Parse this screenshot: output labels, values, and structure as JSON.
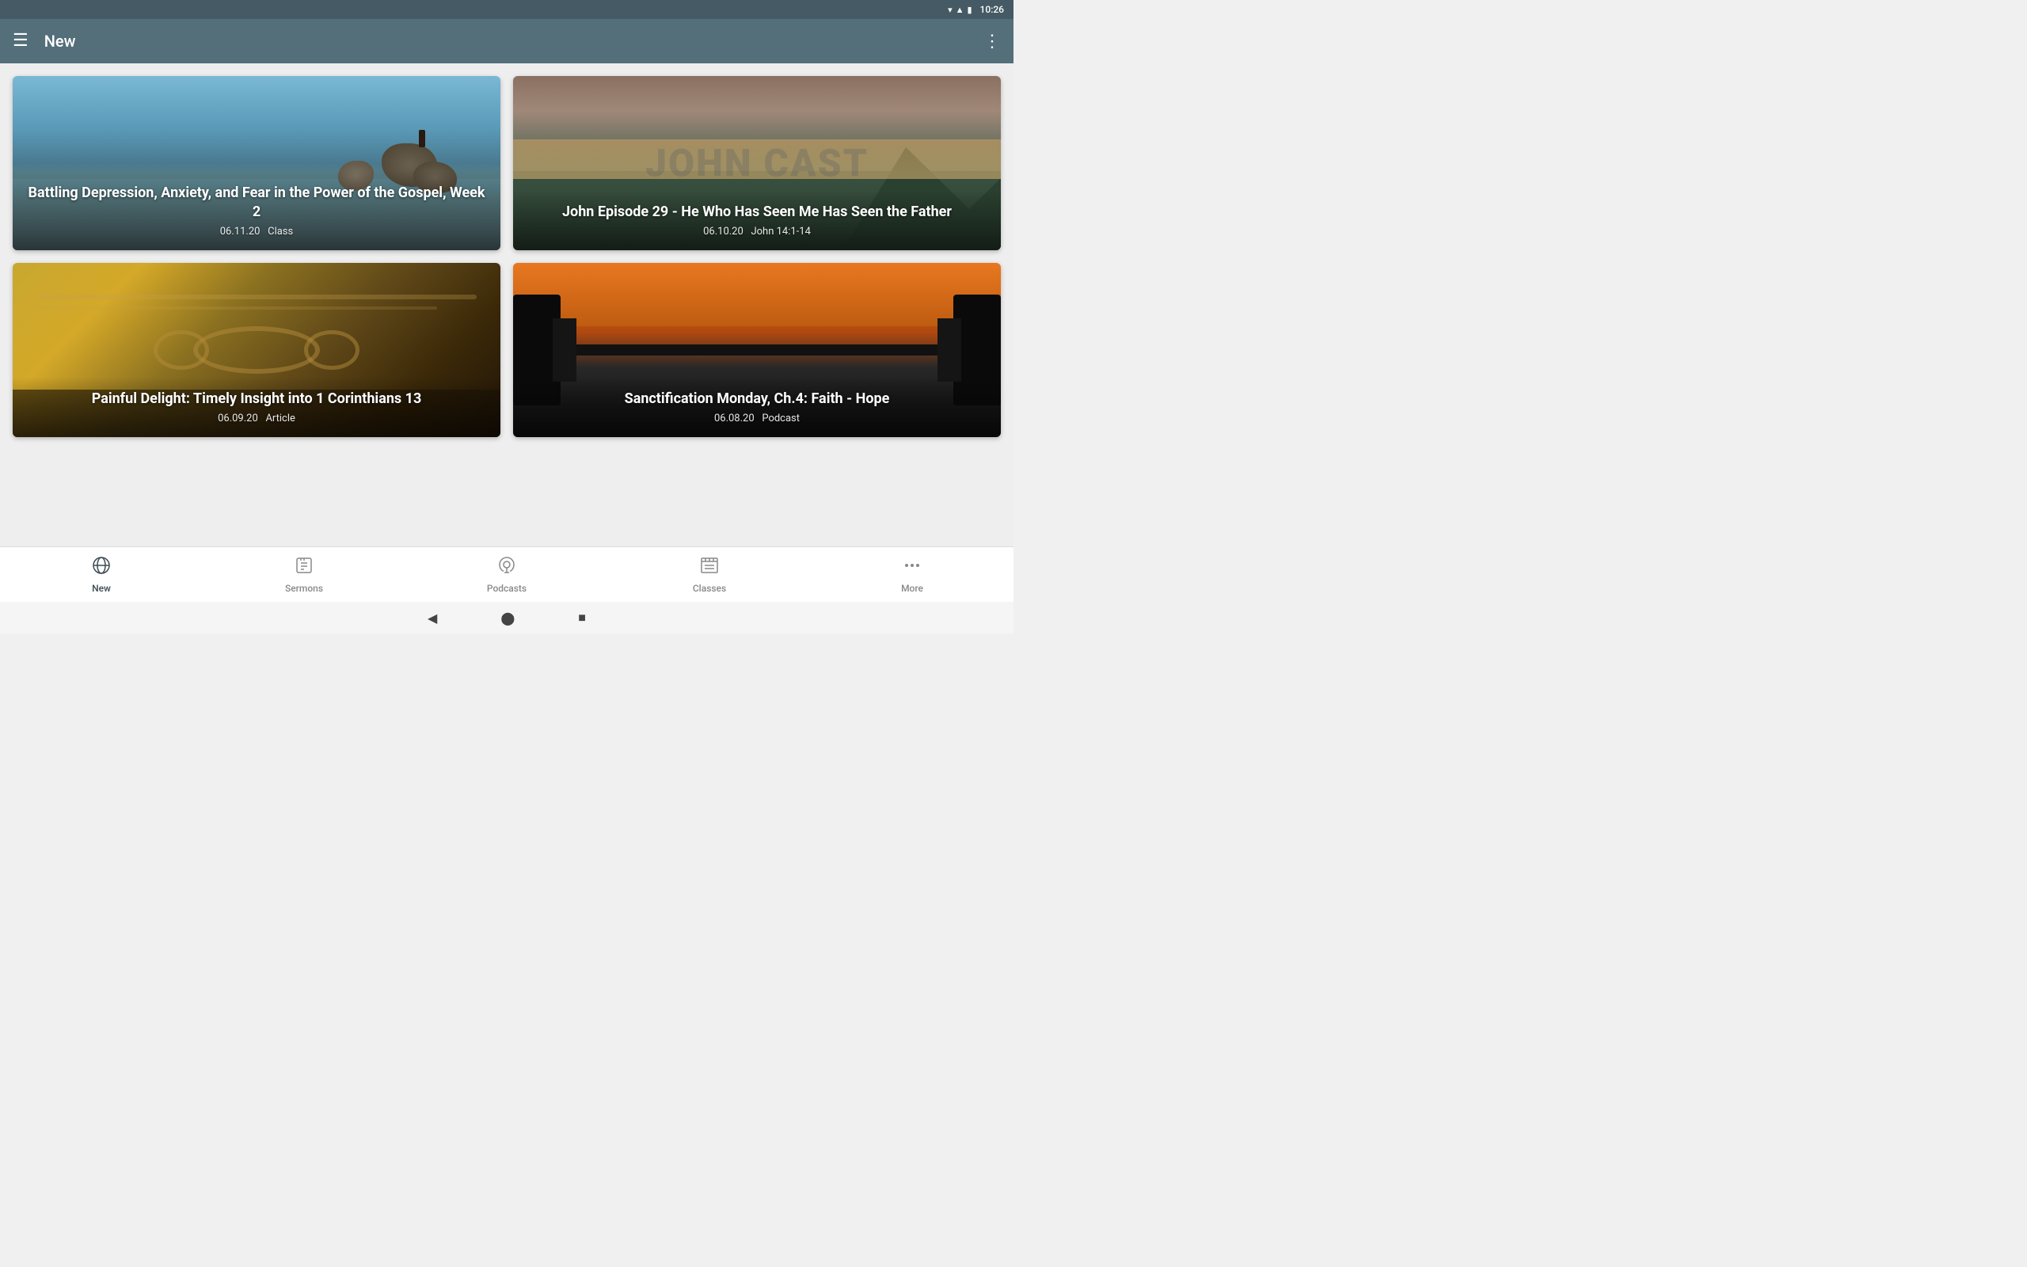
{
  "statusBar": {
    "time": "10:26"
  },
  "appBar": {
    "title": "New",
    "menuIcon": "☰",
    "moreIcon": "⋮"
  },
  "cards": [
    {
      "id": "card-1",
      "title": "Battling Depression, Anxiety, and Fear in the Power of the Gospel, Week 2",
      "date": "06.11.20",
      "category": "Class",
      "bgClass": "card-bg-1"
    },
    {
      "id": "card-2",
      "title": "John Episode 29 - He Who Has Seen Me Has Seen the Father",
      "date": "06.10.20",
      "category": "John 14:1-14",
      "bgClass": "card-bg-2",
      "watermark": "JOHN CAST"
    },
    {
      "id": "card-3",
      "title": "Painful Delight: Timely Insight into 1 Corinthians 13",
      "date": "06.09.20",
      "category": "Article",
      "bgClass": "card-bg-3"
    },
    {
      "id": "card-4",
      "title": "Sanctification Monday, Ch.4: Faith - Hope",
      "date": "06.08.20",
      "category": "Podcast",
      "bgClass": "card-bg-4"
    }
  ],
  "bottomNav": {
    "items": [
      {
        "id": "new",
        "label": "New",
        "icon": "🌐",
        "active": true
      },
      {
        "id": "sermons",
        "label": "Sermons",
        "icon": "📋",
        "active": false
      },
      {
        "id": "podcasts",
        "label": "Podcasts",
        "icon": "🎙",
        "active": false
      },
      {
        "id": "classes",
        "label": "Classes",
        "icon": "📰",
        "active": false
      },
      {
        "id": "more",
        "label": "More",
        "icon": "···",
        "active": false
      }
    ]
  },
  "sysNav": {
    "back": "◀",
    "home": "⬤",
    "recent": "■"
  }
}
